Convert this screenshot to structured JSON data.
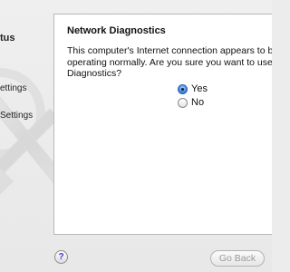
{
  "sidebar": {
    "items": [
      {
        "label": "tus"
      },
      {
        "label": "ettings"
      },
      {
        "label": "Settings"
      }
    ]
  },
  "panel": {
    "title": "Network Diagnostics",
    "lines": [
      "This computer's Internet connection appears to b",
      "operating normally. Are you sure you want to use",
      "Diagnostics?"
    ]
  },
  "options": {
    "yes_label": "Yes",
    "no_label": "No",
    "selected": "Yes"
  },
  "footer": {
    "help_label": "?",
    "back_label": "Go Back"
  }
}
